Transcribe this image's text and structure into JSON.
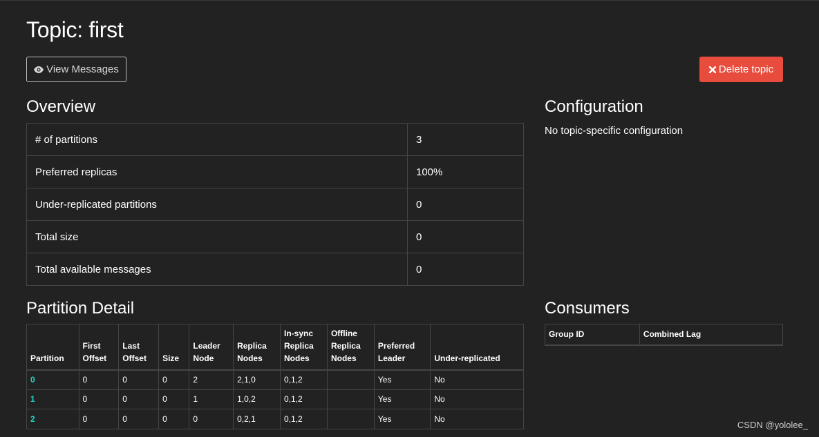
{
  "page": {
    "title": "Topic: first"
  },
  "actions": {
    "view_messages_label": "View Messages",
    "delete_topic_label": "Delete topic"
  },
  "overview": {
    "heading": "Overview",
    "rows": [
      {
        "key": "# of partitions",
        "value": "3"
      },
      {
        "key": "Preferred replicas",
        "value": "100%"
      },
      {
        "key": "Under-replicated partitions",
        "value": "0"
      },
      {
        "key": "Total size",
        "value": "0"
      },
      {
        "key": "Total available messages",
        "value": "0"
      }
    ]
  },
  "configuration": {
    "heading": "Configuration",
    "text": "No topic-specific configuration"
  },
  "partition_detail": {
    "heading": "Partition Detail",
    "headers": [
      [
        "Partition"
      ],
      [
        "First",
        "Offset"
      ],
      [
        "Last",
        "Offset"
      ],
      [
        "Size"
      ],
      [
        "Leader",
        "Node"
      ],
      [
        "Replica",
        "Nodes"
      ],
      [
        "In-sync",
        "Replica",
        "Nodes"
      ],
      [
        "Offline",
        "Replica",
        "Nodes"
      ],
      [
        "Preferred",
        "Leader"
      ],
      [
        "Under-replicated"
      ]
    ],
    "rows": [
      [
        "0",
        "0",
        "0",
        "0",
        "2",
        "2,1,0",
        "0,1,2",
        "",
        "Yes",
        "No"
      ],
      [
        "1",
        "0",
        "0",
        "0",
        "1",
        "1,0,2",
        "0,1,2",
        "",
        "Yes",
        "No"
      ],
      [
        "2",
        "0",
        "0",
        "0",
        "0",
        "0,2,1",
        "0,1,2",
        "",
        "Yes",
        "No"
      ]
    ]
  },
  "consumers": {
    "heading": "Consumers",
    "headers": [
      "Group ID",
      "Combined Lag"
    ]
  },
  "icons": {
    "view": "eye-icon",
    "delete": "close-icon"
  },
  "colors": {
    "background": "#222222",
    "danger": "#e74c3c",
    "link": "#1ed4c7"
  },
  "watermark": "CSDN @yololee_"
}
